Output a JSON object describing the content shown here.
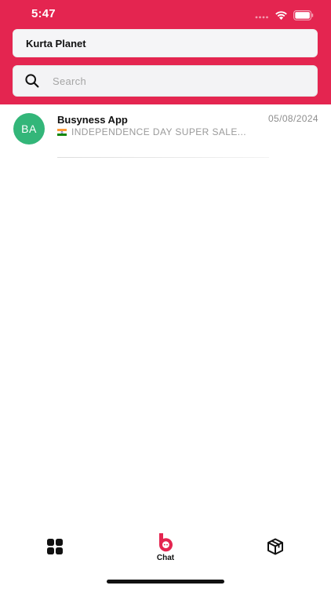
{
  "status_bar": {
    "time": "5:47"
  },
  "header": {
    "store_name": "Kurta Planet",
    "background_color": "#e42550"
  },
  "search": {
    "placeholder": "Search",
    "value": ""
  },
  "chats": [
    {
      "initials": "BA",
      "name": "Busyness App",
      "date": "05/08/2024",
      "preview": "INDEPENDENCE DAY SUPER SALE...",
      "avatar_color": "#33b679"
    }
  ],
  "bottom_nav": {
    "items": [
      {
        "icon": "grid-icon",
        "label": ""
      },
      {
        "icon": "chat-logo-icon",
        "label": "Chat"
      },
      {
        "icon": "box-icon",
        "label": ""
      }
    ]
  }
}
